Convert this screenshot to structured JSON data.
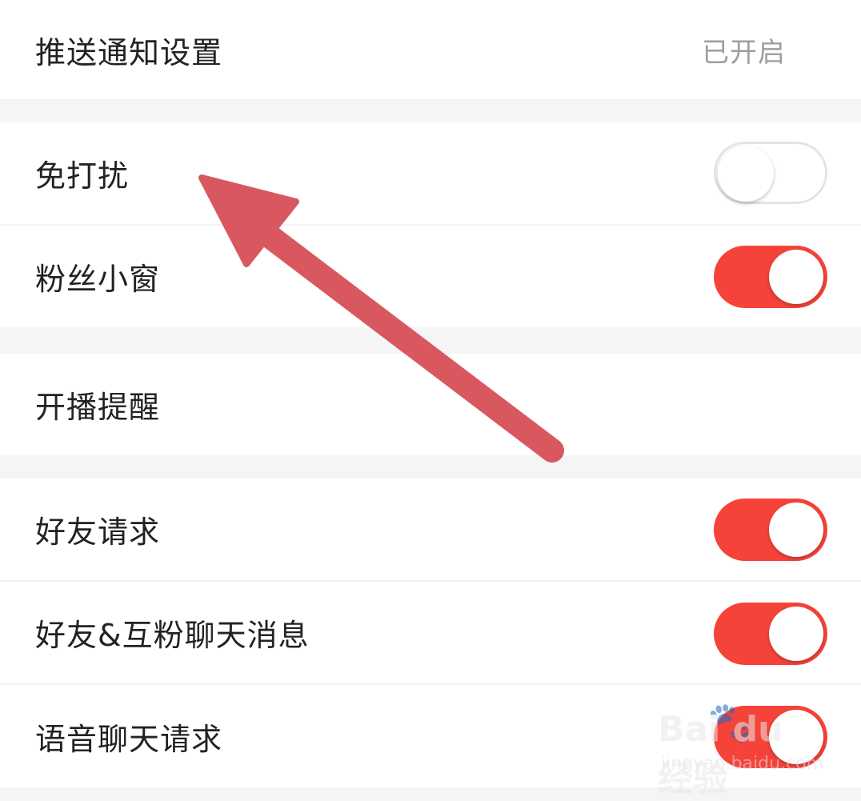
{
  "settings": {
    "push": {
      "label": "推送通知设置",
      "value": "已开启"
    },
    "dnd": {
      "label": "免打扰",
      "enabled": false
    },
    "fan_window": {
      "label": "粉丝小窗",
      "enabled": true
    },
    "live_reminder": {
      "label": "开播提醒"
    },
    "friend_request": {
      "label": "好友请求",
      "enabled": true
    },
    "friend_chat": {
      "label": "好友&互粉聊天消息",
      "enabled": true
    },
    "voice_chat": {
      "label": "语音聊天请求",
      "enabled": true
    }
  },
  "colors": {
    "toggle_on": "#f6433a",
    "arrow": "#d9575e",
    "section_gap": "#f5f5f5"
  },
  "watermark": {
    "brand": "Bai du 经验",
    "url": "jingyan.baidu.com"
  }
}
